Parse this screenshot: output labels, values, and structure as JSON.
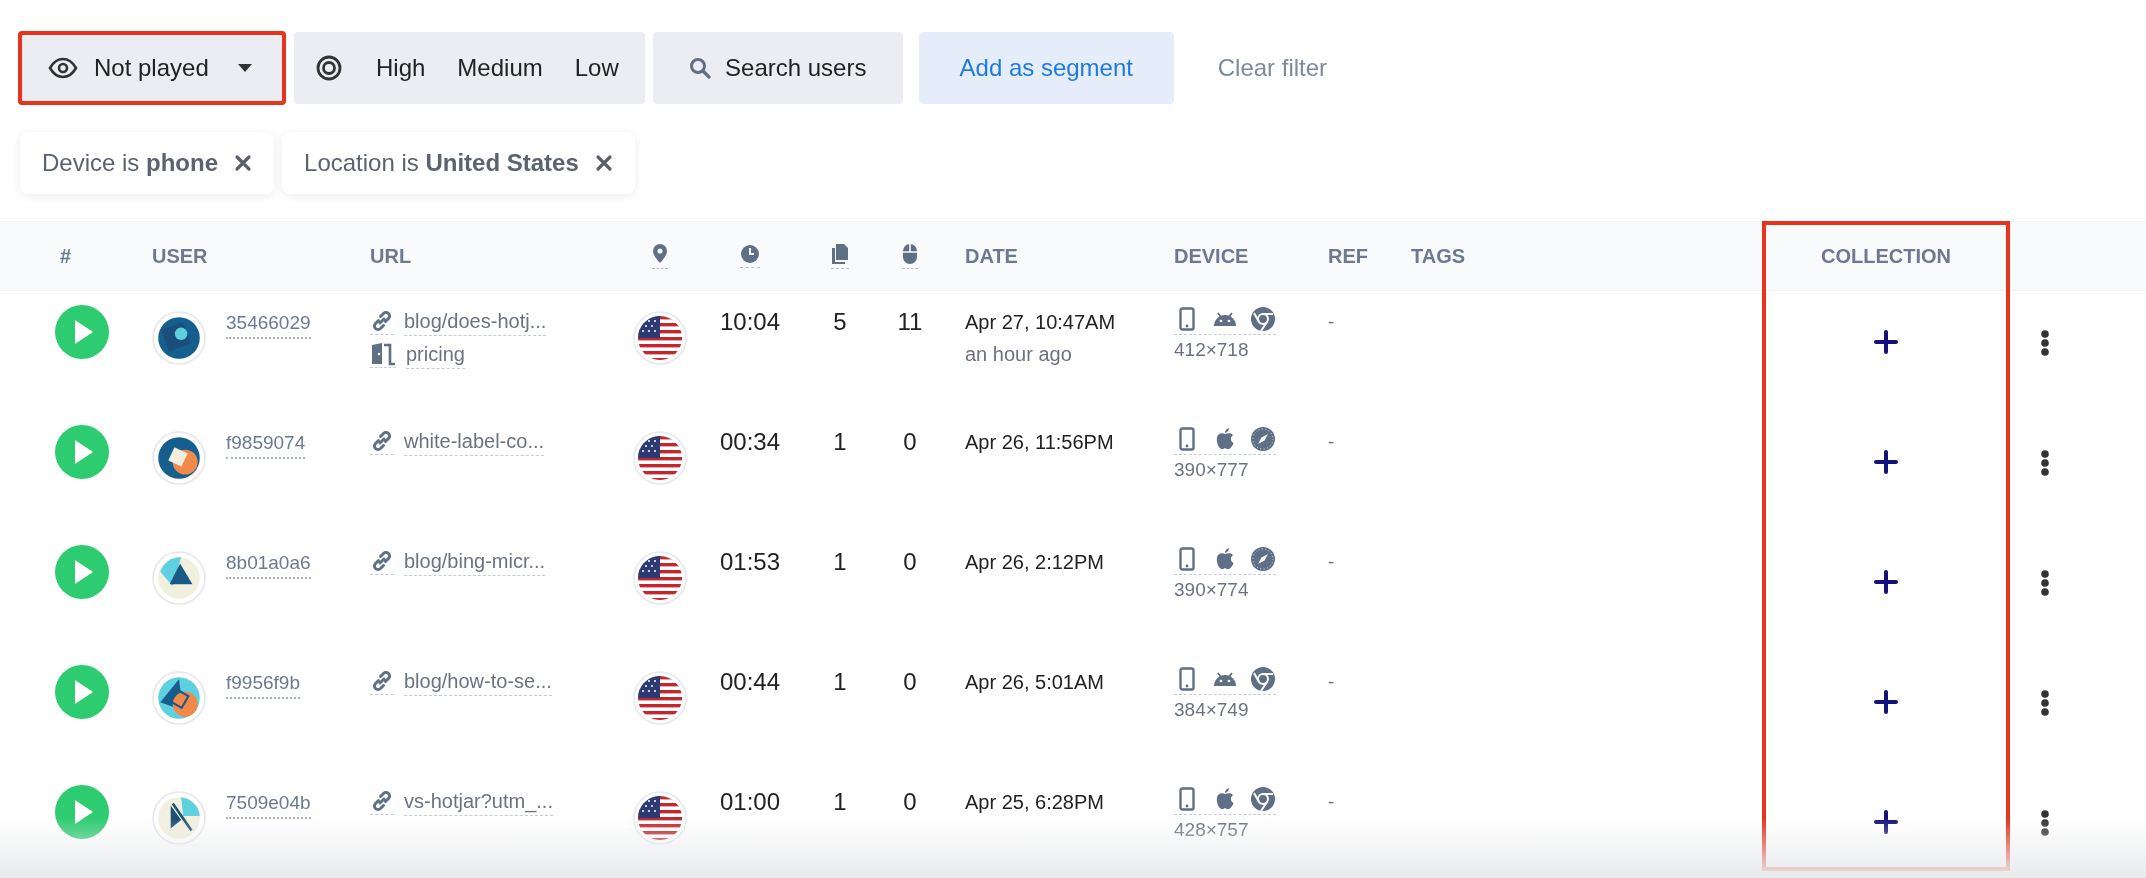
{
  "filters": {
    "visibility": {
      "label": "Not played",
      "highlighted": true
    },
    "priority": {
      "options": [
        {
          "label": "High",
          "selected": false
        },
        {
          "label": "Medium",
          "selected": false
        },
        {
          "label": "Low",
          "selected": false
        }
      ]
    },
    "search": {
      "label": "Search users"
    },
    "add_segment": {
      "label": "Add as segment"
    },
    "clear": {
      "label": "Clear filter"
    }
  },
  "chips": [
    {
      "text": "Device is **phone**"
    },
    {
      "text": "Location is **United States**"
    }
  ],
  "table": {
    "columns": [
      {
        "kind": "text",
        "label": "#"
      },
      {
        "kind": "text",
        "label": "USER"
      },
      {
        "kind": "text",
        "label": "URL"
      },
      {
        "kind": "location"
      },
      {
        "kind": "duration"
      },
      {
        "kind": "pages"
      },
      {
        "kind": "clicks"
      },
      {
        "kind": "text",
        "label": "DATE"
      },
      {
        "kind": "text",
        "label": "DEVICE"
      },
      {
        "kind": "text",
        "label": "REF"
      },
      {
        "kind": "text",
        "label": "TAGS"
      },
      {
        "kind": "text",
        "label": "COLLECTION",
        "highlighted": true
      }
    ],
    "rows": [
      {
        "user": "35466029",
        "urls": [
          {
            "kind": "link",
            "text": "blog/does-hotj..."
          },
          {
            "kind": "exit",
            "text": "pricing"
          }
        ],
        "duration": "10:04",
        "pages": "5",
        "clicks": "11",
        "date": "Apr 27, 10:47AM",
        "ago": "an hour ago",
        "device_icons": [
          {
            "kind": "phone"
          },
          {
            "kind": "android"
          },
          {
            "kind": "chrome"
          }
        ],
        "resolution": "412×718",
        "ref": "-"
      },
      {
        "user": "f9859074",
        "urls": [
          {
            "kind": "link",
            "text": "white-label-co..."
          }
        ],
        "duration": "00:34",
        "pages": "1",
        "clicks": "0",
        "date": "Apr 26, 11:56PM",
        "device_icons": [
          {
            "kind": "phone"
          },
          {
            "kind": "apple"
          },
          {
            "kind": "safari"
          }
        ],
        "resolution": "390×777",
        "ref": "-"
      },
      {
        "user": "8b01a0a6",
        "urls": [
          {
            "kind": "link",
            "text": "blog/bing-micr..."
          }
        ],
        "duration": "01:53",
        "pages": "1",
        "clicks": "0",
        "date": "Apr 26, 2:12PM",
        "device_icons": [
          {
            "kind": "phone"
          },
          {
            "kind": "apple"
          },
          {
            "kind": "safari"
          }
        ],
        "resolution": "390×774",
        "ref": "-"
      },
      {
        "user": "f9956f9b",
        "urls": [
          {
            "kind": "link",
            "text": "blog/how-to-se..."
          }
        ],
        "duration": "00:44",
        "pages": "1",
        "clicks": "0",
        "date": "Apr 26, 5:01AM",
        "device_icons": [
          {
            "kind": "phone"
          },
          {
            "kind": "android"
          },
          {
            "kind": "chrome"
          }
        ],
        "resolution": "384×749",
        "ref": "-"
      },
      {
        "user": "7509e04b",
        "urls": [
          {
            "kind": "link",
            "text": "vs-hotjar?utm_..."
          }
        ],
        "duration": "01:00",
        "pages": "1",
        "clicks": "0",
        "date": "Apr 25, 6:28PM",
        "device_icons": [
          {
            "kind": "phone"
          },
          {
            "kind": "apple"
          },
          {
            "kind": "chrome"
          }
        ],
        "resolution": "428×757",
        "ref": "-"
      }
    ]
  }
}
